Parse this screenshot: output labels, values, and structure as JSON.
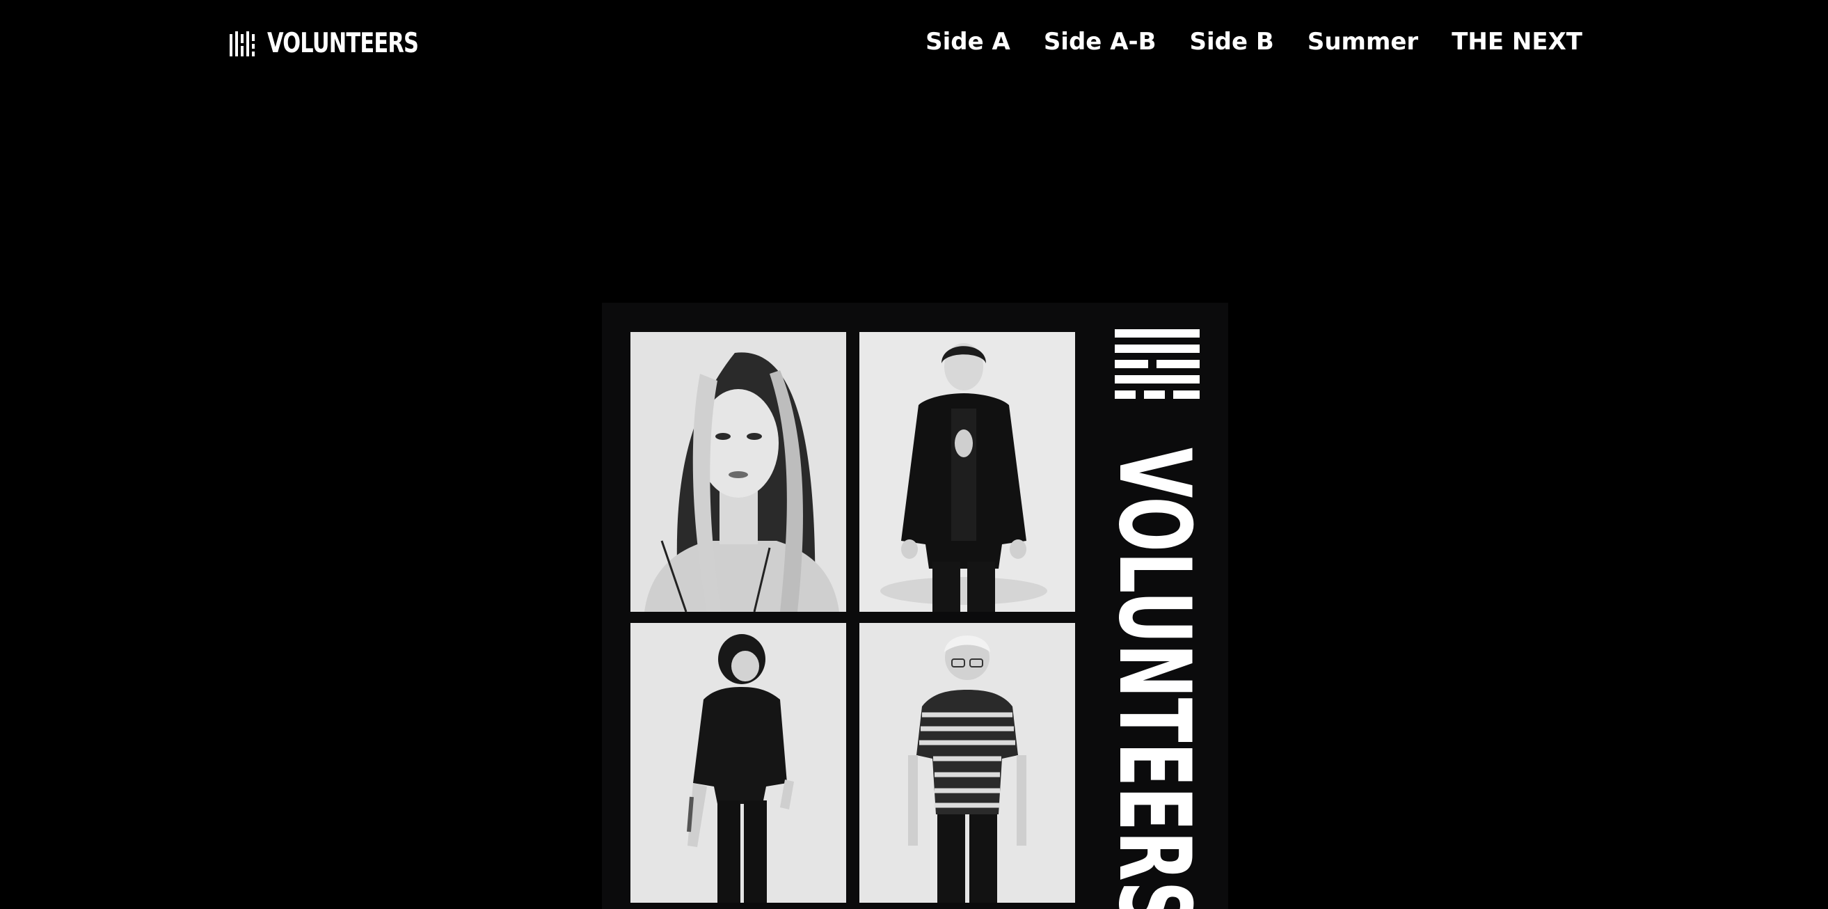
{
  "header": {
    "logo_text": "VOLUNTEERS",
    "logo_icon": "volunteers-logo-icon"
  },
  "nav": {
    "items": [
      {
        "label": "Side A"
      },
      {
        "label": "Side A-B"
      },
      {
        "label": "Side B"
      },
      {
        "label": "Summer"
      },
      {
        "label": "THE NEXT"
      }
    ]
  },
  "album": {
    "cover_text": "VOLUNTEERS",
    "background_color": "#0b0b0c",
    "accent_color": "#ffffff",
    "photo_style": "black-and-white"
  }
}
